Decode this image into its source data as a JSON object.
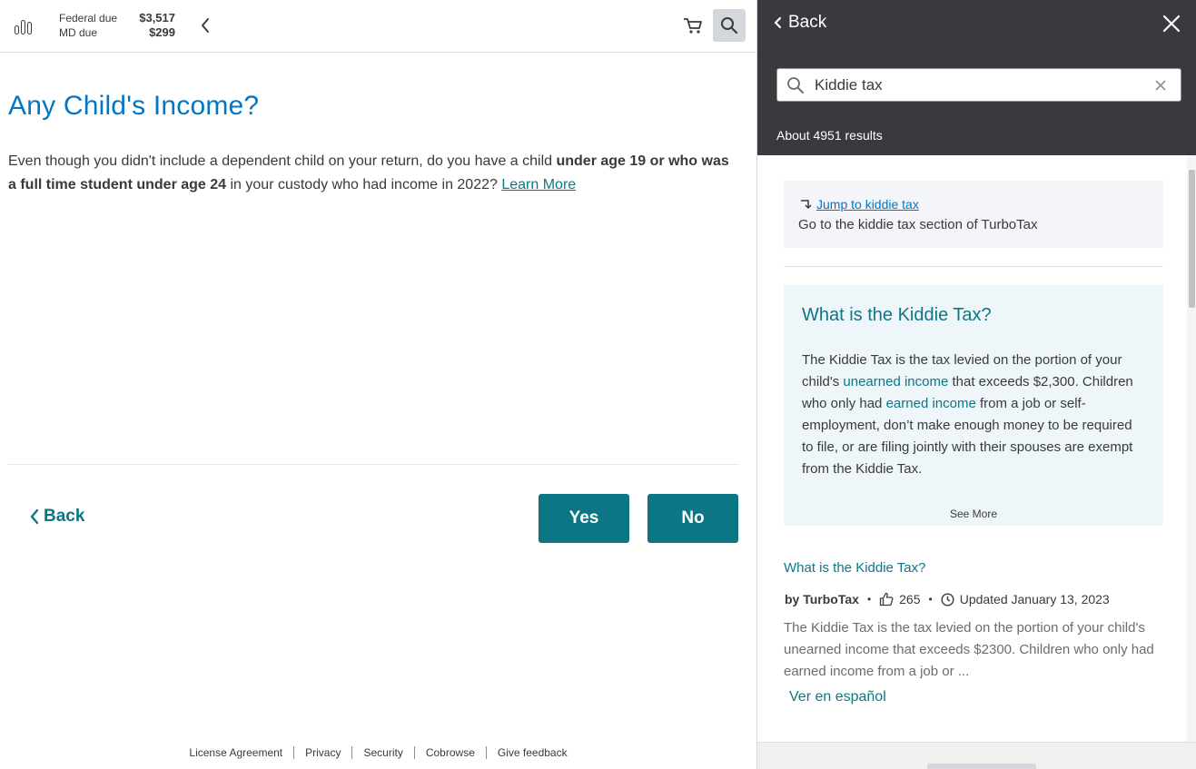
{
  "topbar": {
    "federal_label": "Federal due",
    "federal_amount": "$3,517",
    "state_label": "MD due",
    "state_amount": "$299"
  },
  "main": {
    "title": "Any Child's Income?",
    "question_part1": "Even though you didn't include a dependent child on your return, do you have a child ",
    "question_bold1": "under age 19 or who was a full time student under age 24",
    "question_part2": " in your custody who had income in 2022? ",
    "learn_more": "Learn More",
    "back_label": "Back",
    "yes_label": "Yes",
    "no_label": "No"
  },
  "footer": {
    "links": [
      "License Agreement",
      "Privacy",
      "Security",
      "Cobrowse",
      "Give feedback"
    ]
  },
  "help_panel": {
    "back_label": "Back",
    "search_value": "Kiddie tax",
    "results_count": "About 4951 results",
    "jump": {
      "link": "Jump to kiddie tax",
      "description": "Go to the kiddie tax section of TurboTax"
    },
    "featured": {
      "title": "What is the Kiddie Tax?",
      "text_a": "The Kiddie Tax is the tax levied on the portion of your child's ",
      "link_a": "unearned income",
      "text_b": " that exceeds $2,300. Children who only had ",
      "link_b": "earned income",
      "text_c": " from a job or self-employment, don’t make enough money to be required to file, or are filing jointly with their spouses are exempt from the Kiddie Tax.",
      "see_more": "See More"
    },
    "result": {
      "title": "What is the Kiddie Tax?",
      "author": "by TurboTax",
      "likes": "265",
      "updated": "Updated January 13, 2023",
      "snippet": "The Kiddie Tax is the tax levied on the portion of your child's unearned income that exceeds $2300. Children who only had earned income from a job or ...",
      "spanish_link": "Ver en español"
    }
  },
  "colors": {
    "brand_teal": "#0d7684",
    "title_blue": "#0077c5",
    "panel_header": "#393a3d"
  }
}
